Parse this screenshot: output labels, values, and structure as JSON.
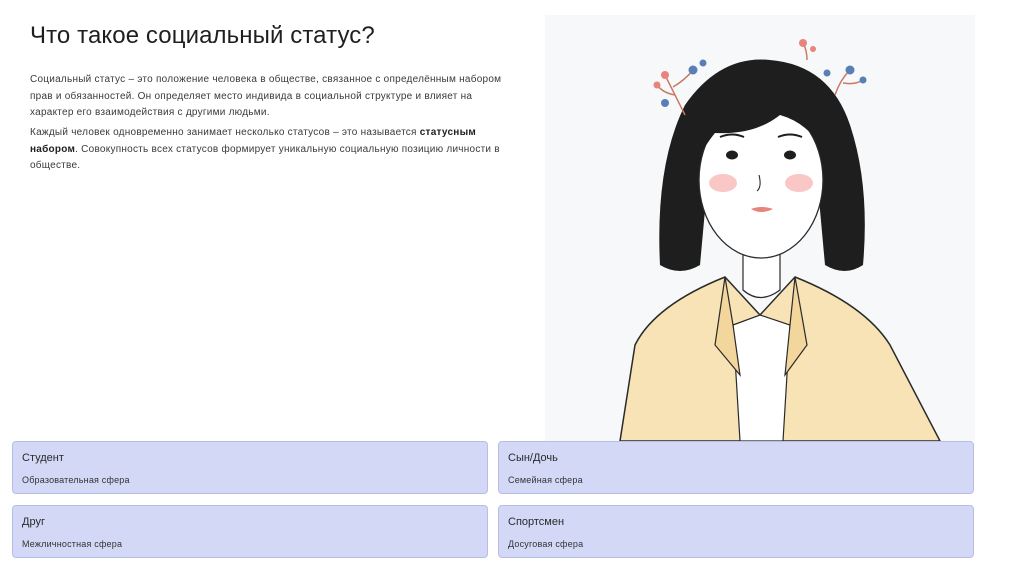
{
  "slide": {
    "title": "Что такое социальный статус?",
    "p1": "Социальный статус – это положение человека в обществе, связанное с определённым набором прав и обязанностей. Он определяет место индивида в социальной структуре и влияет на характер его взаимодействия с другими людьми.",
    "p2_before": "Каждый человек одновременно занимает несколько статусов – это называется ",
    "p2_bold": "статусным набором",
    "p2_after": ". Совокупность всех статусов формирует уникальную социальную позицию личности в обществе."
  },
  "cards": [
    {
      "title": "Студент",
      "subtitle": "Образовательная сфера"
    },
    {
      "title": "Сын/Дочь",
      "subtitle": "Семейная сфера"
    },
    {
      "title": "Друг",
      "subtitle": "Межличностная сфера"
    },
    {
      "title": "Спортсмен",
      "subtitle": "Досуговая сфера"
    }
  ],
  "colors": {
    "card_bg": "#d3d8f6",
    "card_border": "#b7bde6",
    "jacket": "#f7e3b5",
    "hair": "#1e1e1e",
    "flower_red": "#e8847c",
    "flower_blue": "#5a7fb5"
  }
}
